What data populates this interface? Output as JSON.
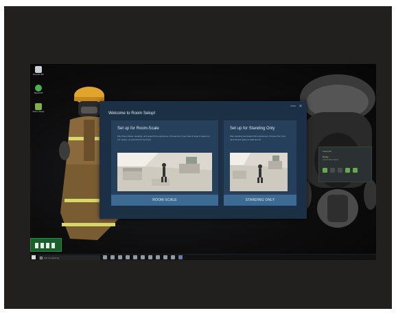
{
  "desktop": {
    "icons": [
      {
        "label": "Recycle Bin",
        "icon": "recycle-bin-icon",
        "color": "#c8d0d6"
      },
      {
        "label": "SteamVR",
        "icon": "steamvr-icon",
        "color": "#4caf50"
      },
      {
        "label": "Room Setup",
        "icon": "room-setup-icon",
        "color": "#7cb342"
      }
    ]
  },
  "dialog": {
    "title": "Welcome to Room Setup!",
    "room_scale": {
      "title": "Set up for Room-Scale",
      "description": "Play Room-Scale, standing, and seated VR experiences. Choose this if you have at least 2 meters by 1.5 meters, or around 6.5 ft by 5 feet.",
      "button": "ROOM-SCALE"
    },
    "standing_only": {
      "title": "Set up for Standing Only",
      "description": "Play standing and seated VR experiences. Choose this if you have limited space to walk around.",
      "button": "STANDING ONLY"
    }
  },
  "widget": {
    "title": "SteamVR",
    "status": "Ready",
    "substatus": "Launch Room Setup"
  },
  "taskbar": {
    "search_placeholder": "Ask me anything"
  },
  "colors": {
    "dialog_bg": "#1b2f45",
    "card_bg": "#26405b",
    "button_bg": "#3c6a93"
  }
}
